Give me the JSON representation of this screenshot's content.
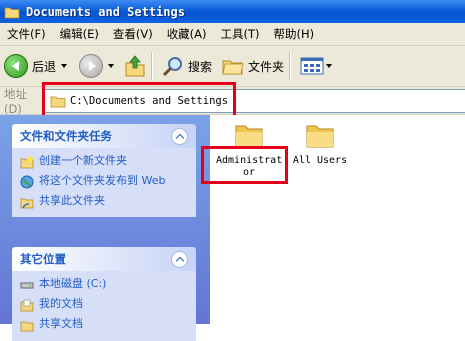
{
  "window": {
    "title": "Documents and Settings"
  },
  "menu": [
    "文件(F)",
    "编辑(E)",
    "查看(V)",
    "收藏(A)",
    "工具(T)",
    "帮助(H)"
  ],
  "toolbar": {
    "back_label": "后退",
    "search_label": "搜索",
    "folders_label": "文件夹"
  },
  "address": {
    "label": "地址(D)",
    "value": "C:\\Documents and Settings"
  },
  "tasks_panel": {
    "title": "文件和文件夹任务",
    "items": [
      "创建一个新文件夹",
      "将这个文件夹发布到 Web",
      "共享此文件夹"
    ]
  },
  "places_panel": {
    "title": "其它位置",
    "items": [
      "本地磁盘 (C:)",
      "我的文档",
      "共享文档"
    ]
  },
  "files": [
    {
      "name": "Administrator",
      "line1": "Administrat",
      "line2": "or"
    },
    {
      "name": "All Users"
    }
  ],
  "colors": {
    "highlight": "#e4001b",
    "title_blue": "#0554d2",
    "link_blue": "#215dc6"
  }
}
